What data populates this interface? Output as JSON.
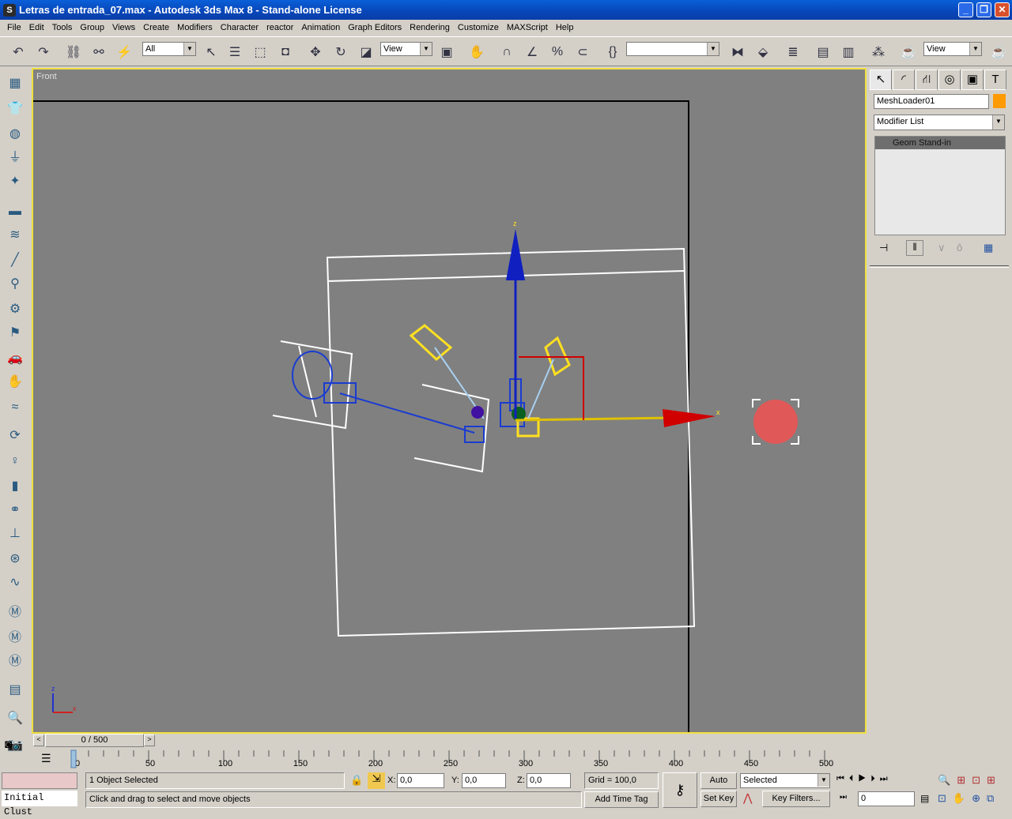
{
  "window": {
    "title": "Letras de entrada_07.max - Autodesk 3ds Max 8  - Stand-alone License",
    "logo": "S"
  },
  "menu": [
    "File",
    "Edit",
    "Tools",
    "Group",
    "Views",
    "Create",
    "Modifiers",
    "Character",
    "reactor",
    "Animation",
    "Graph Editors",
    "Rendering",
    "Customize",
    "MAXScript",
    "Help"
  ],
  "toolbar": {
    "selection_filter": "All",
    "ref_coord": "View",
    "named_selection": "",
    "view_combo": "View"
  },
  "viewport": {
    "label": "Front",
    "axis_z": "z",
    "axis_x": "x",
    "gizmo_z": "z",
    "gizmo_x": "x"
  },
  "command_panel": {
    "object_name": "MeshLoader01",
    "object_color": "#ff9a00",
    "modifier_list": "Modifier List",
    "stack": [
      "Geom Stand-in"
    ]
  },
  "time_slider": {
    "label": "0 / 500",
    "position": 0,
    "total": 500
  },
  "trackbar": {
    "ticks": [
      "0",
      "50",
      "100",
      "150",
      "200",
      "250",
      "300",
      "350",
      "400",
      "450",
      "500"
    ]
  },
  "status": {
    "selection": "1 Object Selected",
    "prompt": "Click and drag to select and move objects",
    "x_label": "X:",
    "x": "0,0",
    "y_label": "Y:",
    "y": "0,0",
    "z_label": "Z:",
    "z": "0,0",
    "grid": "Grid = 100,0",
    "add_time_tag": "Add Time Tag",
    "maxscript_listener": "Initial Clust"
  },
  "animation": {
    "auto_key": "Auto Key",
    "set_key": "Set Key",
    "key_mode": "Selected",
    "key_filters": "Key Filters...",
    "frame": "0"
  }
}
